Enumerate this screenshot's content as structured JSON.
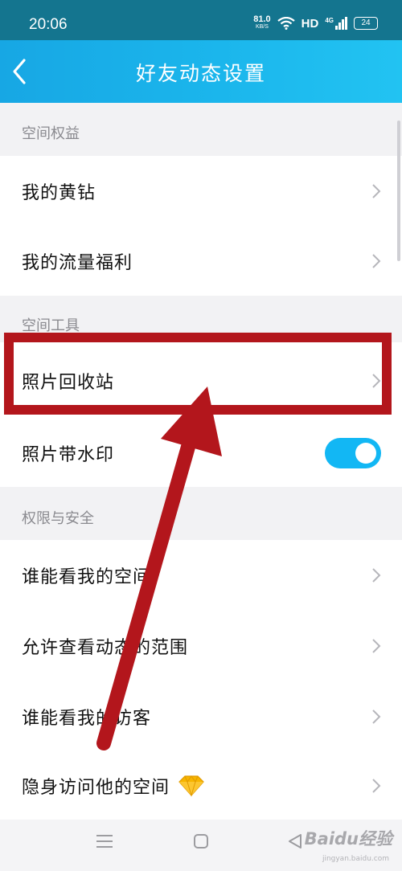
{
  "status_bar": {
    "time": "20:06",
    "net_speed_value": "81.0",
    "net_speed_unit": "KB/S",
    "hd": "HD",
    "network": "4G",
    "battery": "24"
  },
  "header": {
    "title": "好友动态设置",
    "back_icon": "chevron-left-icon"
  },
  "sections": [
    {
      "title": "空间权益",
      "items": [
        {
          "label": "我的黄钻",
          "control": "chevron"
        },
        {
          "label": "我的流量福利",
          "control": "chevron"
        }
      ]
    },
    {
      "title": "空间工具",
      "items": [
        {
          "label": "照片回收站",
          "control": "chevron",
          "highlighted": true
        },
        {
          "label": "照片带水印",
          "control": "toggle",
          "toggle_on": true
        }
      ]
    },
    {
      "title": "权限与安全",
      "items": [
        {
          "label": "谁能看我的空间",
          "control": "chevron"
        },
        {
          "label": "允许查看动态的范围",
          "control": "chevron"
        },
        {
          "label": "谁能看我的访客",
          "control": "chevron"
        },
        {
          "label": "隐身访问他的空间",
          "control": "chevron",
          "badge_icon": "diamond-icon"
        }
      ]
    }
  ],
  "watermark": {
    "text": "Baidu经验",
    "sub": "jingyan.baidu.com"
  },
  "colors": {
    "header_start": "#17a7e4",
    "header_end": "#22c3f2",
    "status_bar": "#14758f",
    "toggle_on": "#12b7f4",
    "annotation_red": "#b3161c",
    "diamond": "#f7b500"
  }
}
